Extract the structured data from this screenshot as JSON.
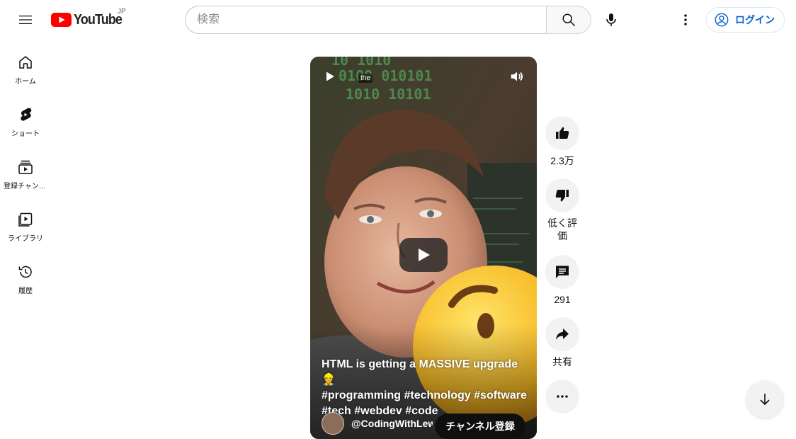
{
  "header": {
    "logo_text": "YouTube",
    "logo_country": "JP",
    "search_placeholder": "検索",
    "login_label": "ログイン",
    "icons": [
      "menu-icon",
      "search-icon",
      "microphone-icon",
      "more-vert-icon",
      "account-circle-icon"
    ]
  },
  "sidebar": {
    "items": [
      {
        "label": "ホーム",
        "icon": "home-icon"
      },
      {
        "label": "ショート",
        "icon": "shorts-icon"
      },
      {
        "label": "登録チャンネル",
        "icon": "subscriptions-icon"
      },
      {
        "label": "ライブラリ",
        "icon": "library-icon"
      },
      {
        "label": "履歴",
        "icon": "history-icon"
      }
    ]
  },
  "video": {
    "caption_tag": "the",
    "title_lines": [
      "HTML is getting a MASSIVE upgrade 👷",
      "#programming #technology #software",
      "#tech #webdev #code"
    ],
    "channel": "@CodingWithLewis",
    "subscribe_label": "チャンネル登録"
  },
  "actions": {
    "like_count": "2.3万",
    "dislike_label": "低く評価",
    "comment_count": "291",
    "share_label": "共有"
  },
  "colors": {
    "brand_red": "#ff0000",
    "link_blue": "#065fd4",
    "button_gray": "#f2f2f2"
  }
}
